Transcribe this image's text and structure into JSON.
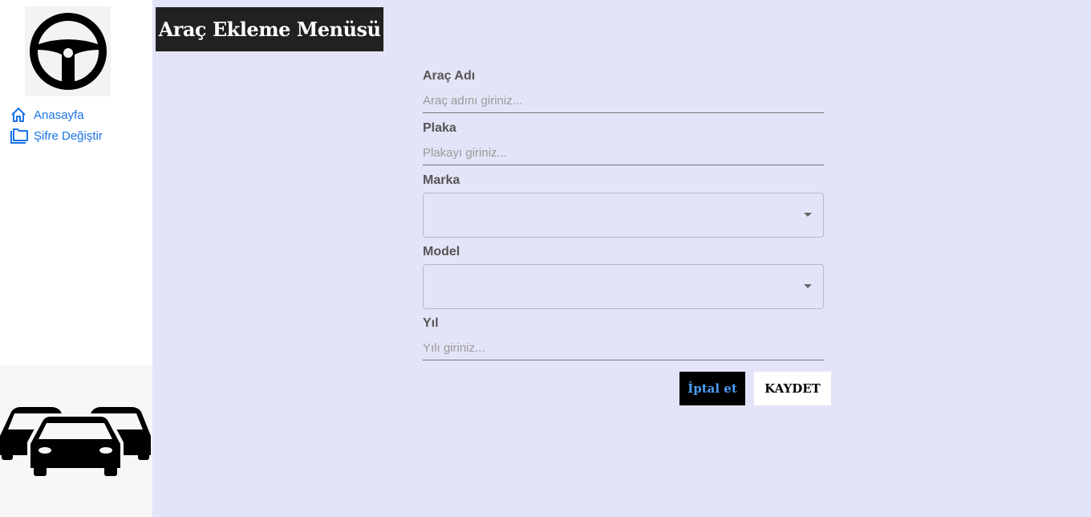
{
  "sidebar": {
    "logo_icon": "steering-wheel-icon",
    "items": [
      {
        "label": "Anasayfa",
        "icon": "home-icon"
      },
      {
        "label": "Şifre Değiştir",
        "icon": "folder-icon"
      }
    ],
    "footer_icon": "cars-icon"
  },
  "header": {
    "title": "Araç Ekleme Menüsü"
  },
  "form": {
    "name": {
      "label": "Araç Adı",
      "placeholder": "Araç adını giriniz...",
      "value": ""
    },
    "plate": {
      "label": "Plaka",
      "placeholder": "Plakayı giriniz...",
      "value": ""
    },
    "brand": {
      "label": "Marka",
      "value": ""
    },
    "model": {
      "label": "Model",
      "value": ""
    },
    "year": {
      "label": "Yıl",
      "placeholder": "Yılı giriniz...",
      "value": ""
    }
  },
  "actions": {
    "cancel_label": "İptal et",
    "save_label": "KAYDET"
  },
  "colors": {
    "background": "#e4e4f8",
    "title_bg": "#212121",
    "link": "#1a73e8",
    "cancel_text": "#4a9cf5"
  }
}
